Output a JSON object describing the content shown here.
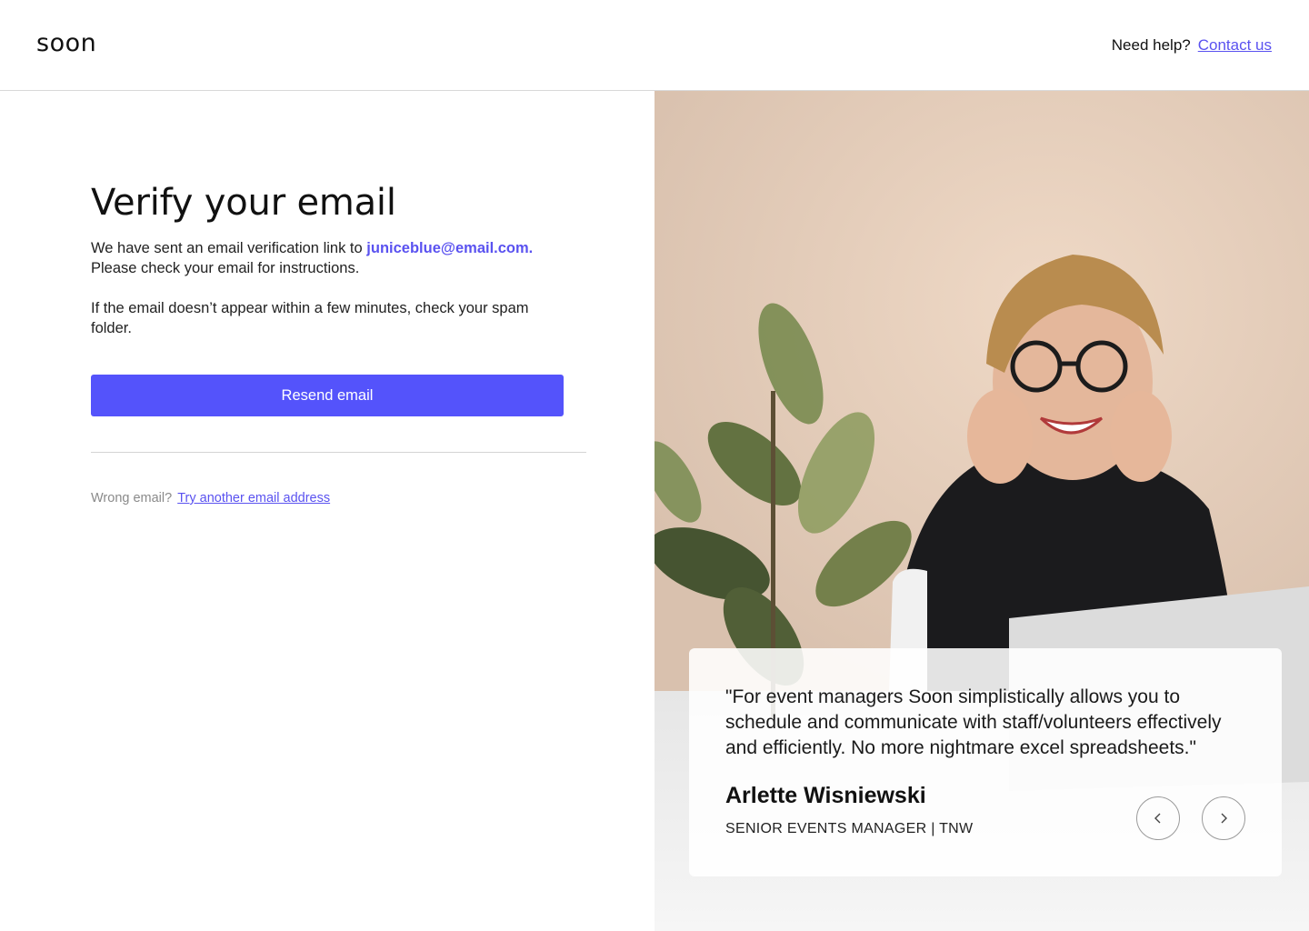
{
  "header": {
    "logo": "soon",
    "help_text": "Need help?",
    "contact_link": "Contact us"
  },
  "verify": {
    "title": "Verify your email",
    "sent_prefix": "We have sent an email verification link to",
    "email": "juniceblue@email.com.",
    "sent_suffix": "Please check your email for instructions.",
    "spam_note": "If the email doesn’t appear within a few minutes, check your spam folder.",
    "resend_label": "Resend email",
    "wrong_email_text": "Wrong email?",
    "try_another_link": "Try another email address"
  },
  "testimonial": {
    "quote": "\"For event managers Soon simplistically allows you to schedule and communicate with staff/volunteers effectively and efficiently. No more nightmare excel spreadsheets.\"",
    "name": "Arlette Wisniewski",
    "role": "SENIOR EVENTS MANAGER | TNW",
    "prev_icon": "chevron-left-icon",
    "next_icon": "chevron-right-icon"
  },
  "colors": {
    "accent": "#5453fb",
    "link": "#5a52f0"
  }
}
